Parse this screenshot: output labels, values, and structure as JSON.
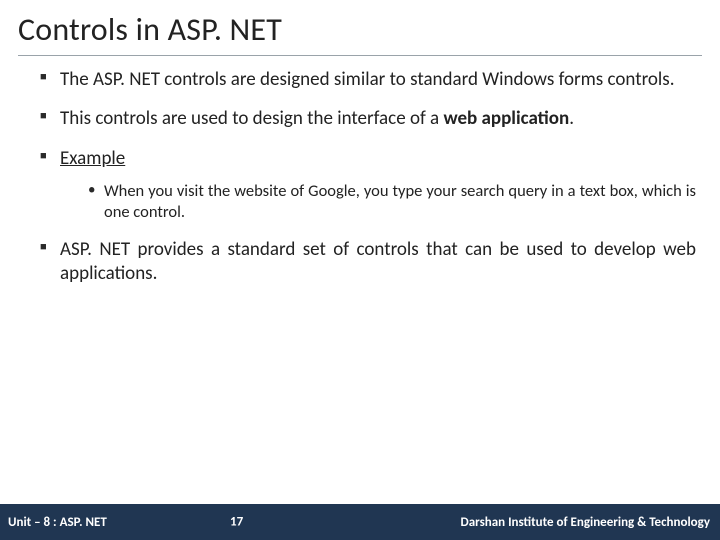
{
  "title": "Controls in ASP. NET",
  "bullets": {
    "b1_text": "The ASP. NET controls are designed similar to standard Windows forms controls.",
    "b2_prefix": "This controls are used to design the interface of a ",
    "b2_bold": "web application",
    "b2_suffix": ".",
    "b3_label": "Example",
    "b3_sub": "When you visit the website of Google, you type your search query in a text box, which is one control.",
    "b4_text": "ASP. NET provides a standard set of controls that can be used to develop web applications."
  },
  "footer": {
    "unit": "Unit – 8 : ASP. NET",
    "page": "17",
    "org": "Darshan Institute of Engineering & Technology"
  },
  "colors": {
    "footer_bg": "#203652",
    "text": "#222222",
    "rule": "#9aa3aa"
  }
}
